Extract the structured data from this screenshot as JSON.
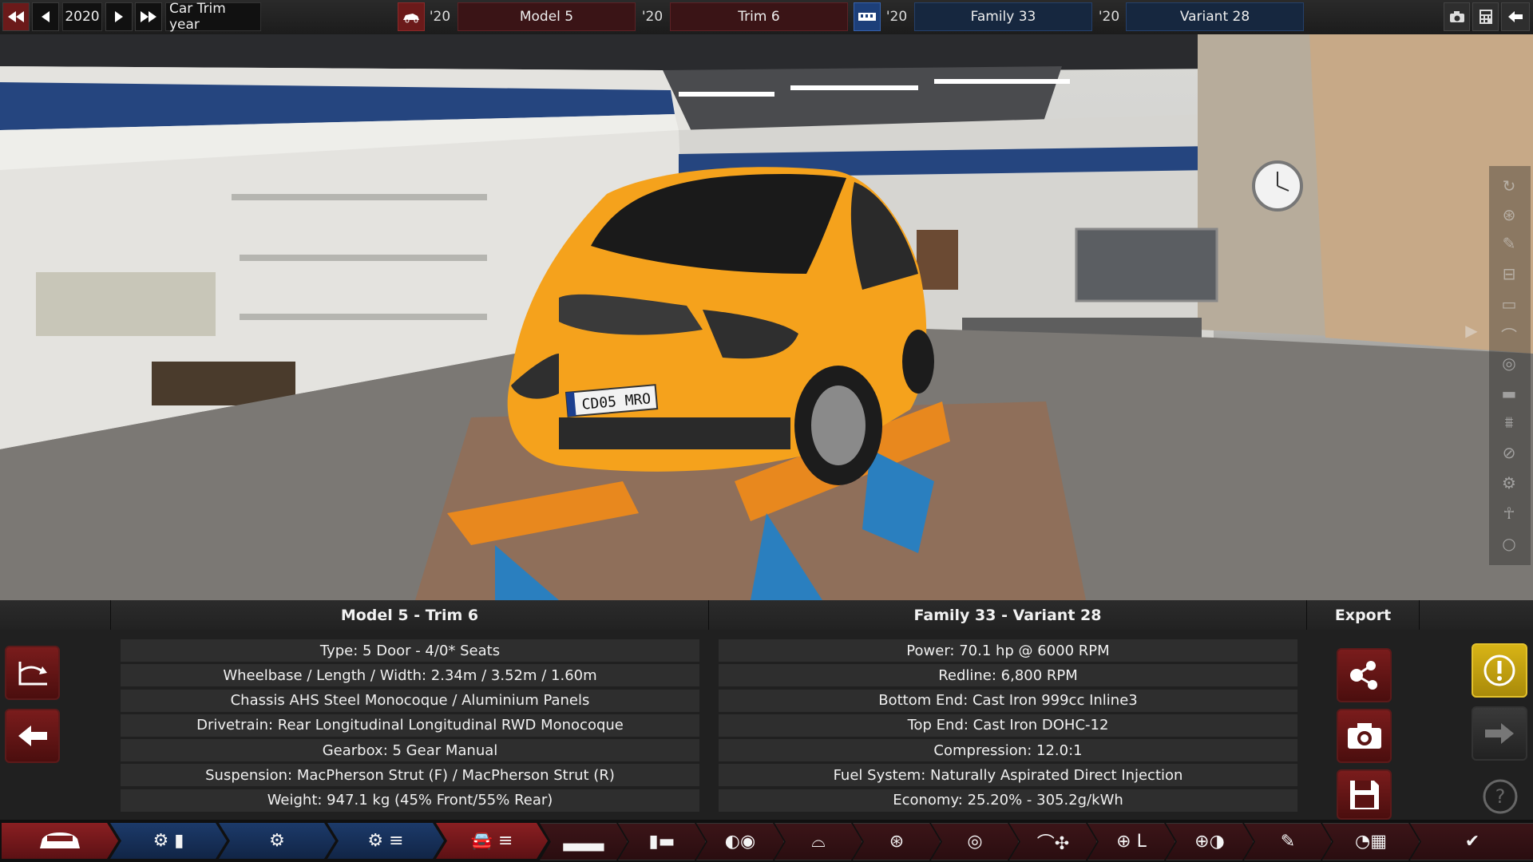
{
  "topbar": {
    "year": "2020",
    "year_label": "Car Trim year",
    "model_year": "'20",
    "model": "Model 5",
    "trim_year": "'20",
    "trim": "Trim 6",
    "family_year": "'20",
    "family": "Family 33",
    "variant_year": "'20",
    "variant": "Variant 28",
    "icons": [
      "skip-back-icon",
      "prev-icon",
      "play-icon",
      "fast-forward-icon",
      "car-body-icon",
      "engine-block-icon",
      "camera-icon",
      "calculator-icon",
      "back-arrow-icon"
    ]
  },
  "scene": {
    "license_plate": "CD05 MRO",
    "car_color": "#f5a21c",
    "side_tools": [
      "rotate-icon",
      "wheel-icon",
      "paint-icon",
      "chassis-icon",
      "panel-icon",
      "roof-icon",
      "lights-icon",
      "bumper-icon",
      "suspension-icon",
      "brake-icon",
      "settings-icon",
      "person-icon",
      "circle-icon"
    ]
  },
  "panel": {
    "trim_header": "Model 5 - Trim 6",
    "trim_specs": [
      "Type: 5 Door - 4/0* Seats",
      "Wheelbase / Length / Width: 2.34m / 3.52m / 1.60m",
      "Chassis AHS Steel Monocoque / Aluminium Panels",
      "Drivetrain: Rear Longitudinal Longitudinal RWD Monocoque",
      "Gearbox: 5 Gear Manual",
      "Suspension: MacPherson Strut (F) / MacPherson Strut (R)",
      "Weight: 947.1 kg (45% Front/55% Rear)"
    ],
    "engine_header": "Family 33 - Variant 28",
    "engine_specs": [
      "Power: 70.1 hp @ 6000 RPM",
      "Redline:  6,800 RPM",
      "Bottom End: Cast Iron 999cc Inline3",
      "Top End: Cast Iron DOHC-12",
      "Compression: 12.0:1",
      "Fuel System: Naturally Aspirated Direct Injection",
      "Economy: 25.20% - 305.2g/kWh"
    ],
    "export_header": "Export"
  },
  "tabs": [
    "car-tab-icon",
    "engine-family-tab-icon",
    "engine-variant-tab-icon",
    "engine-tune-tab-icon",
    "car-model-tab-icon",
    "body-tab-icon",
    "chassis-tab-icon",
    "headlight-tab-icon",
    "suspension-tab-icon",
    "wheels-tab-icon",
    "brakes-tab-icon",
    "aero-tab-icon",
    "interior-tab-icon",
    "rims-tab-icon",
    "paint-tab-icon",
    "test-track-tab-icon",
    "finish-tab-icon"
  ]
}
